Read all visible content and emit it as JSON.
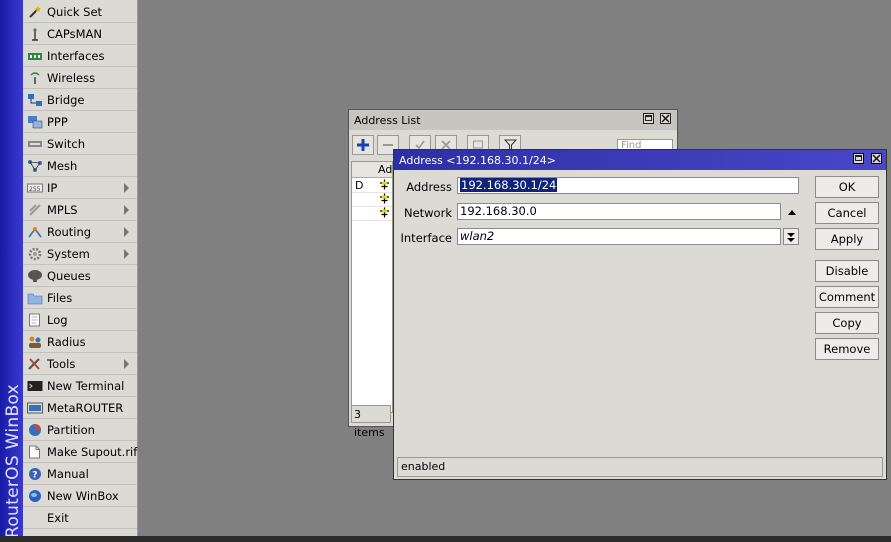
{
  "brand": "RouterOS WinBox",
  "menu": {
    "items": [
      {
        "label": "Quick Set",
        "icon": "wand-icon"
      },
      {
        "label": "CAPsMAN",
        "icon": "antenna-icon"
      },
      {
        "label": "Interfaces",
        "icon": "interfaces-icon"
      },
      {
        "label": "Wireless",
        "icon": "wireless-icon"
      },
      {
        "label": "Bridge",
        "icon": "bridge-icon"
      },
      {
        "label": "PPP",
        "icon": "ppp-icon"
      },
      {
        "label": "Switch",
        "icon": "switch-icon"
      },
      {
        "label": "Mesh",
        "icon": "mesh-icon"
      },
      {
        "label": "IP",
        "icon": "ip-icon",
        "submenu": true
      },
      {
        "label": "MPLS",
        "icon": "mpls-icon",
        "submenu": true
      },
      {
        "label": "Routing",
        "icon": "routing-icon",
        "submenu": true
      },
      {
        "label": "System",
        "icon": "gear-icon",
        "submenu": true
      },
      {
        "label": "Queues",
        "icon": "queues-icon"
      },
      {
        "label": "Files",
        "icon": "folder-icon"
      },
      {
        "label": "Log",
        "icon": "log-icon"
      },
      {
        "label": "Radius",
        "icon": "radius-icon"
      },
      {
        "label": "Tools",
        "icon": "tools-icon",
        "submenu": true
      },
      {
        "label": "New Terminal",
        "icon": "terminal-icon"
      },
      {
        "label": "MetaROUTER",
        "icon": "metarouter-icon"
      },
      {
        "label": "Partition",
        "icon": "partition-icon"
      },
      {
        "label": "Make Supout.rif",
        "icon": "document-icon"
      },
      {
        "label": "Manual",
        "icon": "help-icon"
      },
      {
        "label": "New WinBox",
        "icon": "globe-icon"
      },
      {
        "label": "Exit",
        "icon": "exit-icon"
      }
    ]
  },
  "address_list": {
    "title": "Address List",
    "filter_partial": "Find",
    "column_partial": "Add",
    "rows": [
      {
        "flag": "D"
      },
      {
        "flag": ""
      },
      {
        "flag": ""
      }
    ],
    "status": "3 items"
  },
  "address_dialog": {
    "title": "Address <192.168.30.1/24>",
    "fields": {
      "address_label": "Address",
      "address_value": "192.168.30.1/24",
      "network_label": "Network",
      "network_value": "192.168.30.0",
      "interface_label": "Interface",
      "interface_value": "wlan2"
    },
    "buttons": {
      "ok": "OK",
      "cancel": "Cancel",
      "apply": "Apply",
      "disable": "Disable",
      "comment": "Comment",
      "copy": "Copy",
      "remove": "Remove"
    },
    "status": "enabled"
  },
  "colors": {
    "brand_strip": "#2a2ab8",
    "dialog_title": "#3a3ab8",
    "selection": "#0f2478",
    "desktop": "#808080"
  }
}
